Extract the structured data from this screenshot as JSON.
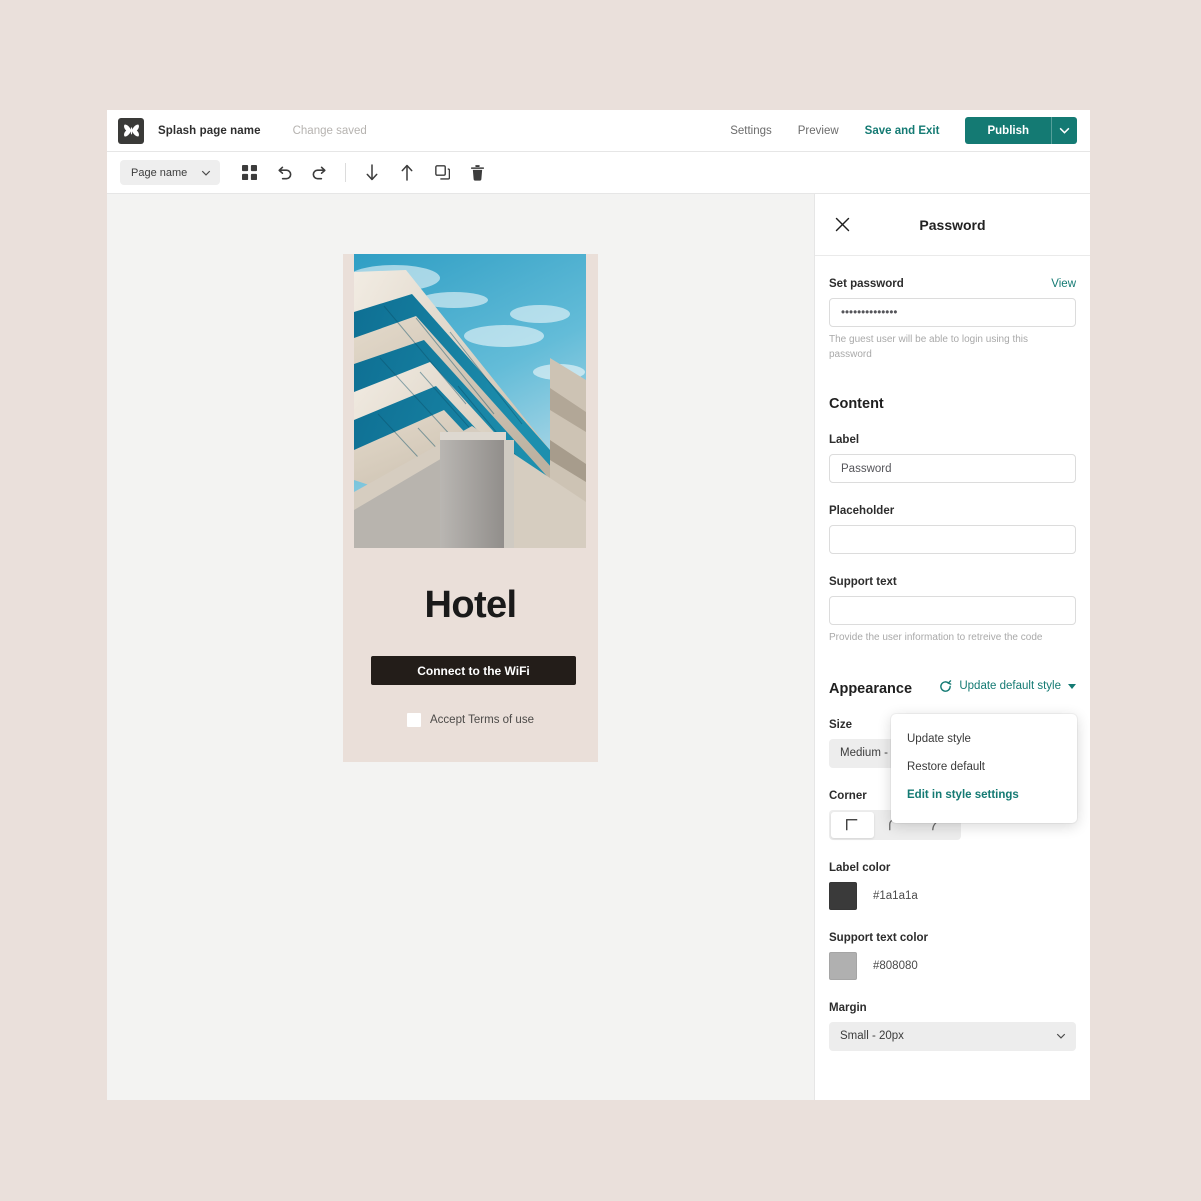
{
  "header": {
    "logo_icon": "butterfly-logo-icon",
    "page_title": "Splash page name",
    "save_status": "Change saved",
    "settings_label": "Settings",
    "preview_label": "Preview",
    "save_exit_label": "Save and Exit",
    "publish_label": "Publish",
    "publish_caret_icon": "chevron-down-icon"
  },
  "toolbar": {
    "page_selector_label": "Page name",
    "page_selector_icon": "chevron-down-icon",
    "buttons": [
      {
        "name": "grid-layout-icon",
        "title": "Layout"
      },
      {
        "name": "undo-icon",
        "title": "Undo"
      },
      {
        "name": "redo-icon",
        "title": "Redo"
      },
      {
        "name": "move-down-icon",
        "title": "Move down"
      },
      {
        "name": "move-up-icon",
        "title": "Move up"
      },
      {
        "name": "duplicate-icon",
        "title": "Duplicate"
      },
      {
        "name": "trash-icon",
        "title": "Delete"
      }
    ]
  },
  "canvas": {
    "background_color": "#f3f3f2",
    "splash": {
      "background_color": "#eadfd9",
      "image_alt": "Modern building facade against blue sky",
      "heading": "Hotel",
      "cta_label": "Connect to the WiFi",
      "cta_color": "#231d19",
      "terms_label": "Accept Terms of use",
      "terms_checked": false
    }
  },
  "panel": {
    "close_icon": "close-icon",
    "title": "Password",
    "set_password": {
      "label": "Set password",
      "view_link": "View",
      "value": "••••••••••••••",
      "help": "The guest user will be able to login using this password"
    },
    "content": {
      "heading": "Content",
      "label_field": {
        "label": "Label",
        "value": "Password"
      },
      "placeholder_field": {
        "label": "Placeholder",
        "value": ""
      },
      "support_field": {
        "label": "Support text",
        "value": "",
        "help": "Provide the user information to retreive the code"
      }
    },
    "appearance": {
      "heading": "Appearance",
      "update_default_style": {
        "label": "Update default style",
        "refresh_icon": "refresh-icon",
        "caret_icon": "caret-down-icon"
      },
      "size": {
        "label": "Size",
        "value": "Medium - 4",
        "icon": "chevron-down-icon"
      },
      "corner": {
        "label": "Corner",
        "options": [
          "square-corner-icon",
          "rounded-corner-icon",
          "pill-corner-icon"
        ],
        "selected_index": 0
      },
      "label_color": {
        "label": "Label color",
        "value": "#1a1a1a"
      },
      "support_text_color": {
        "label": "Support text color",
        "value": "#808080"
      },
      "margin": {
        "label": "Margin",
        "value": "Small - 20px",
        "icon": "chevron-down-icon"
      }
    }
  },
  "style_menu": {
    "items": [
      {
        "label": "Update style",
        "accent": false
      },
      {
        "label": "Restore default",
        "accent": false
      },
      {
        "label": "Edit in style settings",
        "accent": true
      }
    ]
  },
  "colors": {
    "accent": "#147a73",
    "page_background": "#eae0db",
    "dark": "#231d19"
  }
}
